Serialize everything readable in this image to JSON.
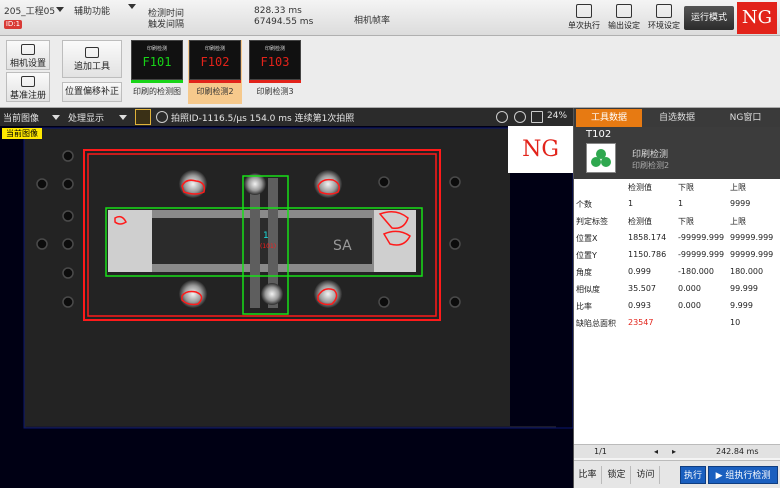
{
  "top": {
    "project_menu": "205_工程05",
    "assist_menu": "辅助功能",
    "badge": "ID:1",
    "detect_time_label": "检测时间",
    "trigger_interval_label": "触发间隔",
    "detect_time_value": "828.33 ms",
    "trigger_interval_value": "67494.55 ms",
    "camera_fps_label": "相机帧率",
    "btn_single_exec": "单次执行",
    "btn_output_setting": "输出设定",
    "btn_env_setting": "环境设定",
    "btn_mode": "运行模式",
    "ng_badge": "NG"
  },
  "toolbar2": {
    "camera_settings": "相机设置",
    "register_ref": "基准注册",
    "add_tool": "追加工具",
    "position_comp": "位置偏移补正",
    "tools": [
      {
        "thumb_title": "印刷检测",
        "code": "F101",
        "label": "印刷的检测图",
        "color": "#17d417"
      },
      {
        "thumb_title": "印刷检测",
        "code": "F102",
        "label": "印刷检测2",
        "color": "#e2231a"
      },
      {
        "thumb_title": "印刷检测",
        "code": "F103",
        "label": "印刷检测3",
        "color": "#e2231a"
      }
    ]
  },
  "viewbar": {
    "current_image": "当前图像",
    "processing_display": "处理显示",
    "capture_info": "拍照ID-1116.5/μs 154.0 ms  连续第1次拍照",
    "zoom": "24%"
  },
  "image": {
    "current_label": "当前图像",
    "ng_label": "NG",
    "region_label": "1",
    "pcb_text": "SA"
  },
  "panel": {
    "tabs": [
      "工具数据",
      "自选数据",
      "NG窗口"
    ],
    "tool_id": "T102",
    "tool_name": "印刷检测",
    "tool_sub": "印刷检测2",
    "headers": [
      "",
      "检测值",
      "下限",
      "上限"
    ],
    "rows": [
      {
        "name": "个数",
        "value": "1",
        "low": "1",
        "high": "9999",
        "ng": false
      },
      {
        "name": "判定标签",
        "value": "检测值",
        "low": "下限",
        "high": "上限",
        "ng": false
      },
      {
        "name": "位置X",
        "value": "1858.174",
        "low": "-99999.999",
        "high": "99999.999",
        "ng": false
      },
      {
        "name": "位置Y",
        "value": "1150.786",
        "low": "-99999.999",
        "high": "99999.999",
        "ng": false
      },
      {
        "name": "角度",
        "value": "0.999",
        "low": "-180.000",
        "high": "180.000",
        "ng": false
      },
      {
        "name": "相似度",
        "value": "35.507",
        "low": "0.000",
        "high": "99.999",
        "ng": false
      },
      {
        "name": "比率",
        "value": "0.993",
        "low": "0.000",
        "high": "9.999",
        "ng": false
      },
      {
        "name": "缺陷总面积",
        "value": "23547",
        "low": "",
        "high": "10",
        "ng": true
      }
    ],
    "page": "1/1",
    "exec_time": "242.84 ms",
    "buttons": {
      "compare": "比率",
      "lock": "锁定",
      "access": "访问",
      "exec": "执行",
      "group_exec": "组执行检测"
    }
  }
}
